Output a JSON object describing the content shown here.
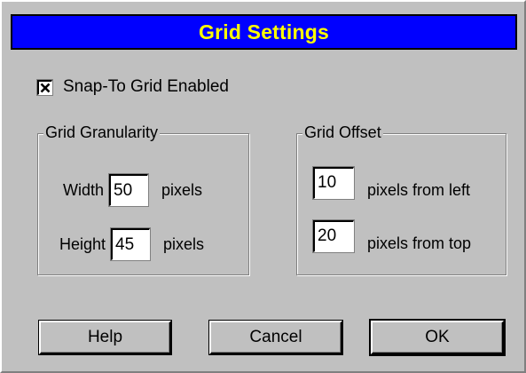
{
  "dialog": {
    "title": "Grid Settings",
    "title_color": "#ffff00",
    "titlebar_color": "#0000ff"
  },
  "snap": {
    "label": "Snap-To Grid Enabled",
    "checked": true
  },
  "granularity": {
    "label": "Grid Granularity",
    "width_label": "Width",
    "width_value": "50",
    "width_unit": "pixels",
    "height_label": "Height",
    "height_value": "45",
    "height_unit": "pixels"
  },
  "offset": {
    "label": "Grid Offset",
    "left_value": "10",
    "left_unit": "pixels from left",
    "top_value": "20",
    "top_unit": "pixels from top"
  },
  "buttons": {
    "help": "Help",
    "cancel": "Cancel",
    "ok": "OK"
  }
}
